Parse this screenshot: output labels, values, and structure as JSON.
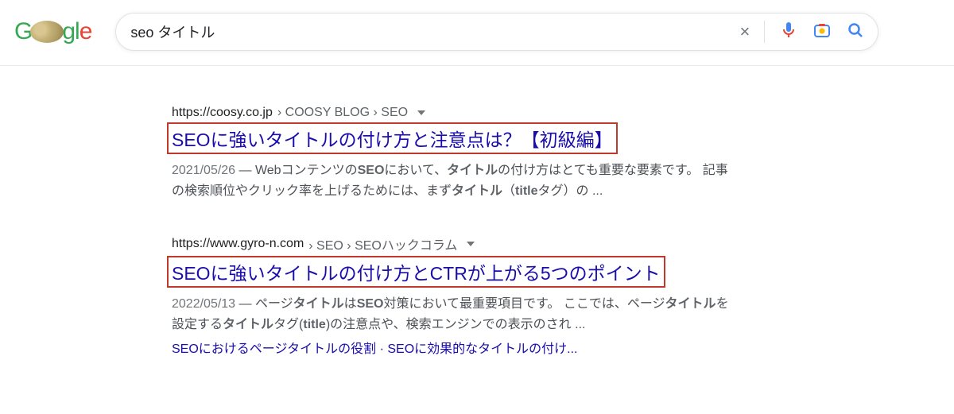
{
  "search": {
    "query": "seo タイトル"
  },
  "results": [
    {
      "domain": "https://coosy.co.jp",
      "path": " › COOSY BLOG › SEO",
      "title": "SEOに強いタイトルの付け方と注意点は？【初級編】",
      "date": "2021/05/26",
      "snippet_pre": " — Webコンテンツの",
      "b1": "SEO",
      "s2": "において、",
      "b2": "タイトル",
      "s3": "の付け方はとても重要な要素です。 記事の検索順位やクリック率を上げるためには、まず",
      "b3": "タイトル",
      "s4": "（",
      "b4": "title",
      "s5": "タグ）の ..."
    },
    {
      "domain": "https://www.gyro-n.com",
      "path": " › SEO › SEOハックコラム",
      "title": "SEOに強いタイトルの付け方とCTRが上がる5つのポイント",
      "date": "2022/05/13",
      "snippet_pre": " — ページ",
      "b1": "タイトル",
      "s2": "は",
      "b2": "SEO",
      "s3": "対策において最重要項目です。 ここでは、ページ",
      "b3": "タイト",
      "s3b": "ル",
      "s4": "を設定する",
      "b4": "タイトル",
      "s5": "タグ(",
      "b5": "title",
      "s6": ")の注意点や、検索エンジンでの表示のされ ...",
      "sitelinks": "SEOにおけるページタイトルの役割 · SEOに効果的なタイトルの付け..."
    }
  ]
}
